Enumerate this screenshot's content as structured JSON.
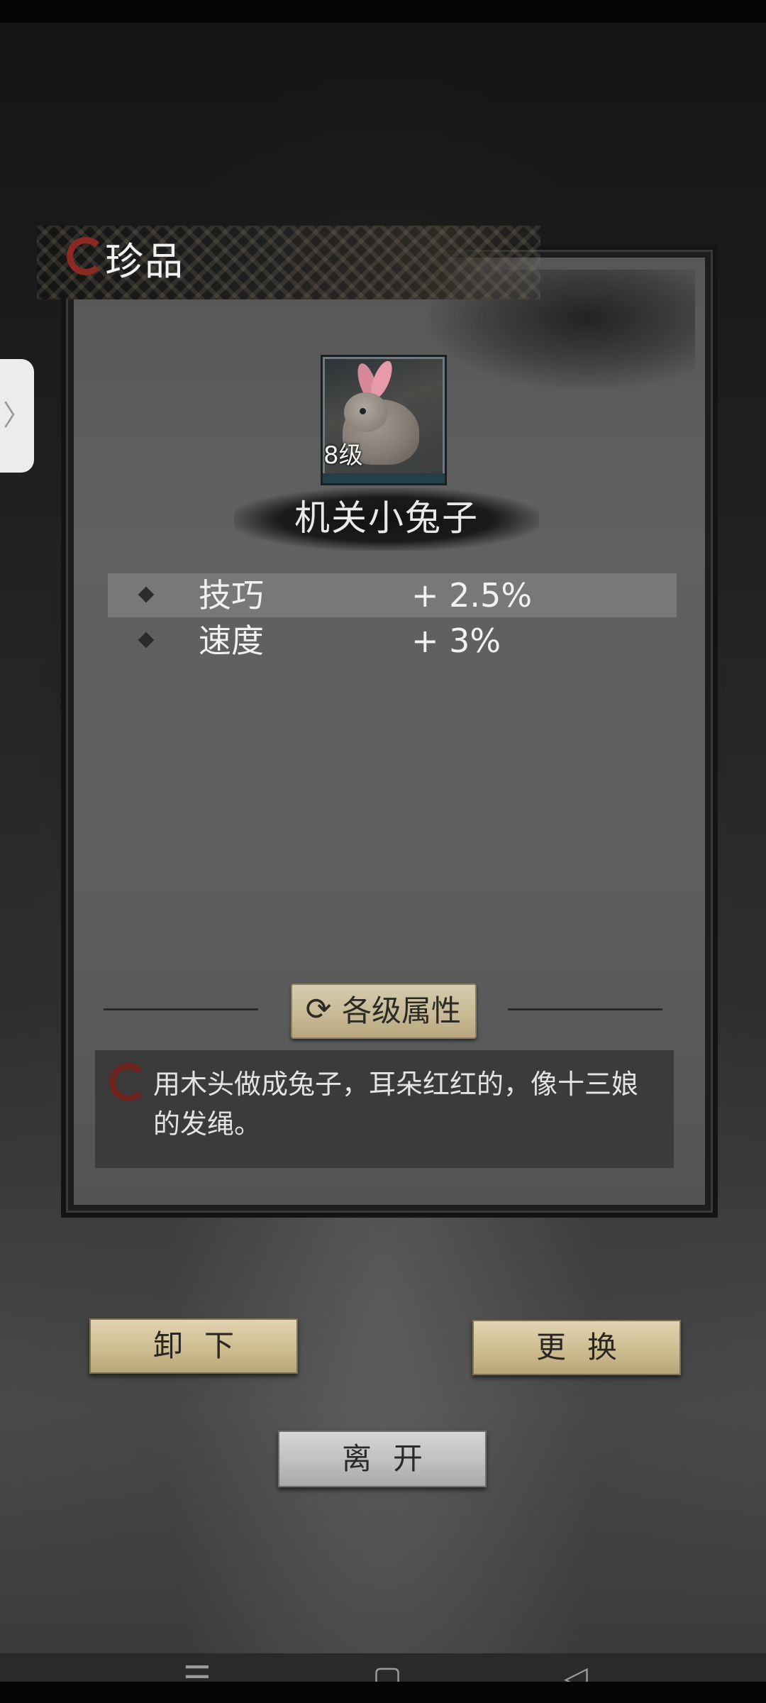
{
  "dialog": {
    "title": "珍品",
    "item": {
      "level": "8级",
      "name": "机关小兔子",
      "icon": "mechanical-rabbit-icon"
    },
    "stats": [
      {
        "name": "技巧",
        "value": "+ 2.5%"
      },
      {
        "name": "速度",
        "value": "+ 3%"
      }
    ],
    "attr_button_label": "各级属性",
    "description": "用木头做成兔子，耳朵红红的，像十三娘的发绳。"
  },
  "actions": {
    "unequip": "卸下",
    "replace": "更换",
    "leave": "离开"
  },
  "side_tab": {
    "icon": "chevron-right-icon",
    "glyph": "〉"
  },
  "nav": {
    "menu_glyph": "☰",
    "home_glyph": "▢",
    "back_glyph": "◁"
  },
  "colors": {
    "accent_seal": "#8a2a22",
    "button_gold": "#cdbd91",
    "button_grey": "#bdbdbd"
  }
}
